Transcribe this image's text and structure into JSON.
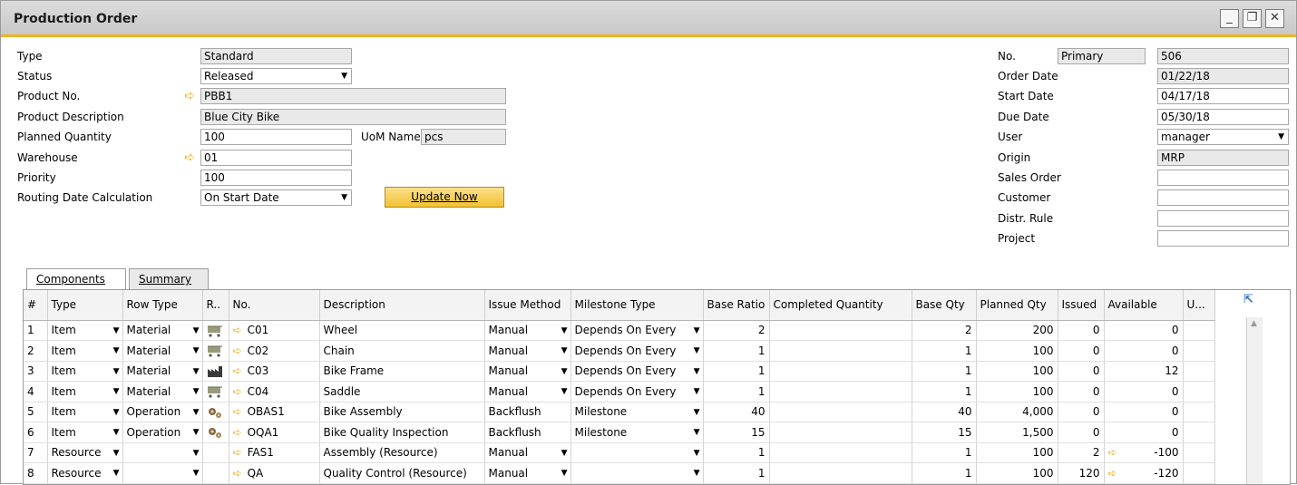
{
  "window": {
    "title": "Production Order",
    "buttons": [
      "_",
      "❐",
      "✕"
    ]
  },
  "header_left": {
    "type_label": "Type",
    "type_value": "Standard",
    "status_label": "Status",
    "status_value": "Released",
    "product_no_label": "Product No.",
    "product_no_value": "PBB1",
    "product_desc_label": "Product Description",
    "product_desc_value": "Blue City Bike",
    "planned_qty_label": "Planned Quantity",
    "planned_qty_value": "100",
    "uom_label": "UoM Name",
    "uom_value": "pcs",
    "warehouse_label": "Warehouse",
    "warehouse_value": "01",
    "priority_label": "Priority",
    "priority_value": "100",
    "routing_label": "Routing Date Calculation",
    "routing_value": "On Start Date",
    "update_button": "Update Now"
  },
  "header_right": {
    "no_label": "No.",
    "series_value": "Primary",
    "no_value": "506",
    "order_date_label": "Order Date",
    "order_date_value": "01/22/18",
    "start_date_label": "Start Date",
    "start_date_value": "04/17/18",
    "due_date_label": "Due Date",
    "due_date_value": "05/30/18",
    "user_label": "User",
    "user_value": "manager",
    "origin_label": "Origin",
    "origin_value": "MRP",
    "sales_order_label": "Sales Order",
    "sales_order_value": "",
    "customer_label": "Customer",
    "customer_value": "",
    "distr_rule_label": "Distr. Rule",
    "distr_rule_value": "",
    "project_label": "Project",
    "project_value": ""
  },
  "tabs": {
    "components": "Components",
    "summary": "Summary"
  },
  "grid": {
    "columns": [
      "#",
      "Type",
      "Row Type",
      "R..",
      "No.",
      "Description",
      "Issue Method",
      "Milestone Type",
      "Base Ratio",
      "Completed Quantity",
      "Base Qty",
      "Planned Qty",
      "Issued",
      "Available",
      "U..."
    ],
    "rows": [
      {
        "n": "1",
        "type": "Item",
        "row_type": "Material",
        "icon": "cart-icon",
        "no": "C01",
        "desc": "Wheel",
        "issue": "Manual",
        "milestone": "Depends On Every",
        "base_ratio": "2",
        "completed": "",
        "base_qty": "2",
        "planned": "200",
        "issued": "0",
        "available": "0",
        "avail_arrow": false
      },
      {
        "n": "2",
        "type": "Item",
        "row_type": "Material",
        "icon": "cart-icon",
        "no": "C02",
        "desc": "Chain",
        "issue": "Manual",
        "milestone": "Depends On Every",
        "base_ratio": "1",
        "completed": "",
        "base_qty": "1",
        "planned": "100",
        "issued": "0",
        "available": "0",
        "avail_arrow": false
      },
      {
        "n": "3",
        "type": "Item",
        "row_type": "Material",
        "icon": "factory-icon",
        "no": "C03",
        "desc": "Bike Frame",
        "issue": "Manual",
        "milestone": "Depends On Every",
        "base_ratio": "1",
        "completed": "",
        "base_qty": "1",
        "planned": "100",
        "issued": "0",
        "available": "12",
        "avail_arrow": false
      },
      {
        "n": "4",
        "type": "Item",
        "row_type": "Material",
        "icon": "cart-icon",
        "no": "C04",
        "desc": "Saddle",
        "issue": "Manual",
        "milestone": "Depends On Every",
        "base_ratio": "1",
        "completed": "",
        "base_qty": "1",
        "planned": "100",
        "issued": "0",
        "available": "0",
        "avail_arrow": false
      },
      {
        "n": "5",
        "type": "Item",
        "row_type": "Operation",
        "icon": "gears-icon",
        "no": "OBAS1",
        "desc": "Bike Assembly",
        "issue": "Backflush",
        "milestone": "Milestone",
        "base_ratio": "40",
        "completed": "",
        "base_qty": "40",
        "planned": "4,000",
        "issued": "0",
        "available": "0",
        "avail_arrow": false
      },
      {
        "n": "6",
        "type": "Item",
        "row_type": "Operation",
        "icon": "gears-icon",
        "no": "OQA1",
        "desc": "Bike Quality Inspection",
        "issue": "Backflush",
        "milestone": "Milestone",
        "base_ratio": "15",
        "completed": "",
        "base_qty": "15",
        "planned": "1,500",
        "issued": "0",
        "available": "0",
        "avail_arrow": false
      },
      {
        "n": "7",
        "type": "Resource",
        "row_type": "",
        "icon": "",
        "no": "FAS1",
        "desc": "Assembly (Resource)",
        "issue": "Manual",
        "milestone": "",
        "base_ratio": "1",
        "completed": "",
        "base_qty": "1",
        "planned": "100",
        "issued": "2",
        "available": "-100",
        "avail_arrow": true
      },
      {
        "n": "8",
        "type": "Resource",
        "row_type": "",
        "icon": "",
        "no": "QA",
        "desc": "Quality Control (Resource)",
        "issue": "Manual",
        "milestone": "",
        "base_ratio": "1",
        "completed": "",
        "base_qty": "1",
        "planned": "100",
        "issued": "120",
        "available": "-120",
        "avail_arrow": true
      }
    ]
  },
  "colors": {
    "accent": "#f0b323",
    "field_bg": "#e9e9e9",
    "link_blue": "#2f6fc4"
  }
}
